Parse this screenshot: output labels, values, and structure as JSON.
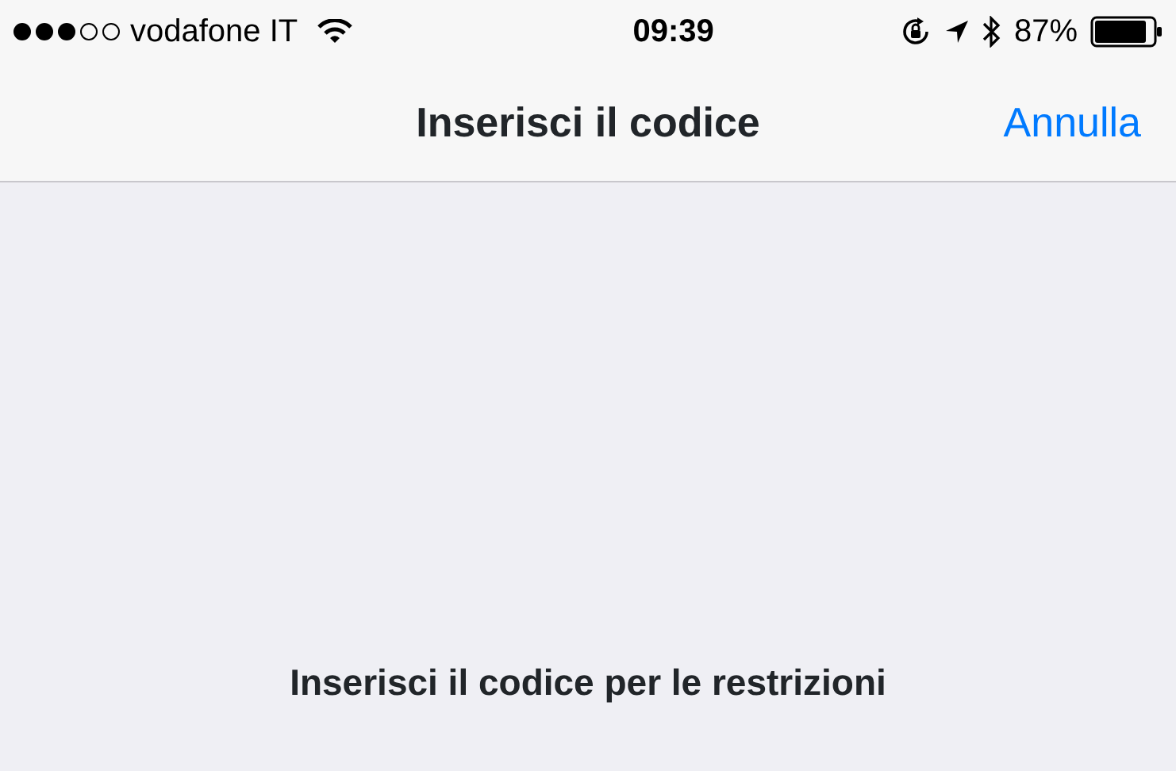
{
  "status_bar": {
    "carrier": "vodafone IT",
    "time": "09:39",
    "battery": "87%"
  },
  "nav_bar": {
    "title": "Inserisci il codice",
    "action": "Annulla"
  },
  "prompt": "Inserisci il codice per le restrizioni"
}
